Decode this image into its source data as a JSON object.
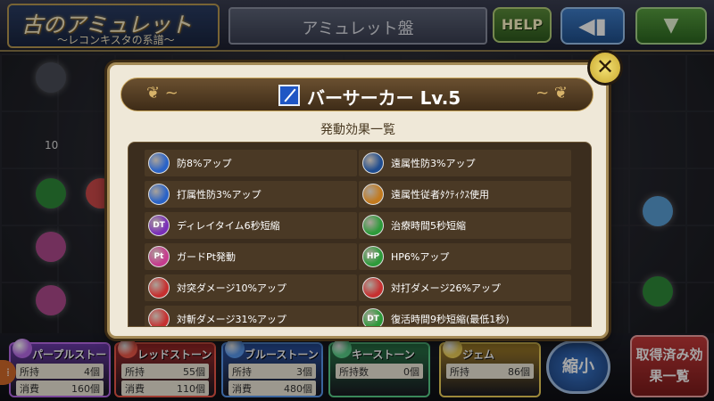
{
  "header": {
    "logo_title": "古のアミュレット",
    "logo_subtitle": "〜レコンキスタの系譜〜",
    "screen_title": "アミュレット盤",
    "help_label": "HELP",
    "back_icon": "back-arrow-icon",
    "menu_icon": "chevron-down-icon"
  },
  "board": {
    "cell_count_label": "10"
  },
  "modal": {
    "class_icon": "sword-icon",
    "title": "バーサーカー Lv.5",
    "section_title": "発動効果一覧",
    "close_icon": "close-x-icon",
    "effects": [
      {
        "label": "防8%アップ",
        "icon_color": "#2a63c7",
        "icon_text": ""
      },
      {
        "label": "遠属性防3%アップ",
        "icon_color": "#1f4c8f",
        "icon_text": ""
      },
      {
        "label": "打属性防3%アップ",
        "icon_color": "#2a63c7",
        "icon_text": ""
      },
      {
        "label": "遠属性従者ﾀｸﾃｨｸｽ使用",
        "icon_color": "#c27a1e",
        "icon_text": ""
      },
      {
        "label": "ディレイタイム6秒短縮",
        "icon_color": "#7a2fb8",
        "icon_text": "DT"
      },
      {
        "label": "治療時間5秒短縮",
        "icon_color": "#2d9a3a",
        "icon_text": ""
      },
      {
        "label": "ガードPt発動",
        "icon_color": "#c63c8e",
        "icon_text": "Pt"
      },
      {
        "label": "HP6%アップ",
        "icon_color": "#2d9a3a",
        "icon_text": "HP"
      },
      {
        "label": "対突ダメージ10%アップ",
        "icon_color": "#c63030",
        "icon_text": ""
      },
      {
        "label": "対打ダメージ26%アップ",
        "icon_color": "#c63030",
        "icon_text": ""
      },
      {
        "label": "対斬ダメージ31%アップ",
        "icon_color": "#c63030",
        "icon_text": ""
      },
      {
        "label": "復活時間9秒短縮(最低1秒)",
        "icon_color": "#2d9a3a",
        "icon_text": "DT"
      }
    ]
  },
  "stones": [
    {
      "label": "パープルストーン",
      "color": "#6a3aa8",
      "gem": "#b86ae8",
      "rows": [
        {
          "k": "所持",
          "v": "4個"
        },
        {
          "k": "消費",
          "v": "160個"
        }
      ]
    },
    {
      "label": "レッドストーン",
      "color": "#a82a2a",
      "gem": "#f05a4a",
      "rows": [
        {
          "k": "所持",
          "v": "55個"
        },
        {
          "k": "消費",
          "v": "110個"
        }
      ]
    },
    {
      "label": "ブルーストーン",
      "color": "#2a54a8",
      "gem": "#5a9af0",
      "rows": [
        {
          "k": "所持",
          "v": "3個"
        },
        {
          "k": "消費",
          "v": "480個"
        }
      ]
    },
    {
      "label": "キーストーン",
      "color": "#2a7a4a",
      "gem": "#5ad08a",
      "rows": [
        {
          "k": "所持数",
          "v": "0個"
        }
      ]
    },
    {
      "label": "ジェム",
      "color": "#a8822a",
      "gem": "#f0d25a",
      "rows": [
        {
          "k": "所持",
          "v": "86個"
        }
      ]
    }
  ],
  "buttons": {
    "shrink_label": "縮小",
    "acquired_list_label": "取得済み効果一覧"
  }
}
